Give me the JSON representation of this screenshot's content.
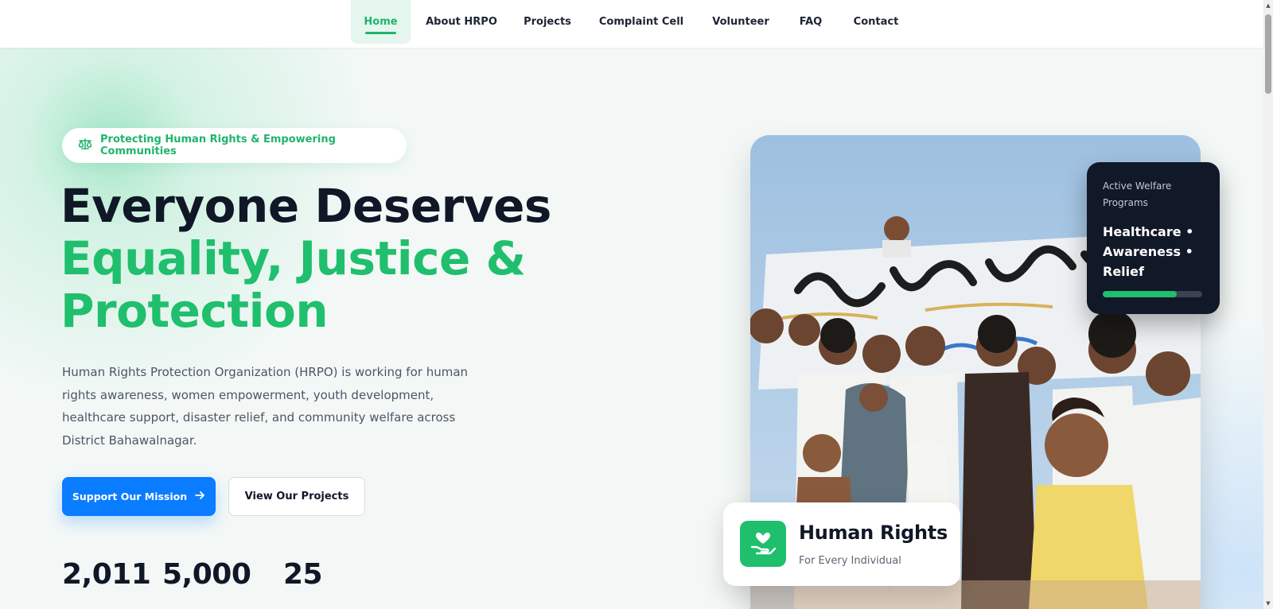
{
  "nav": {
    "items": [
      {
        "label": "Home",
        "active": true
      },
      {
        "label": "About HRPO",
        "active": false
      },
      {
        "label": "Projects",
        "active": false
      },
      {
        "label": "Complaint Cell",
        "active": false
      },
      {
        "label": "Volunteer",
        "active": false
      },
      {
        "label": "FAQ",
        "active": false
      },
      {
        "label": "Contact",
        "active": false
      }
    ]
  },
  "hero": {
    "badge_icon": "scales-icon",
    "badge_text": "Protecting Human Rights & Empowering Communities",
    "headline_line1": "Everyone Deserves",
    "headline_line2": "Equality, Justice &",
    "headline_line3": "Protection",
    "description": "Human Rights Protection Organization (HRPO) is working for human rights awareness, women empowerment, youth development, healthcare support, disaster relief, and community welfare across District Bahawalnagar.",
    "primary_button": "Support Our Mission",
    "primary_button_icon": "arrow-right-icon",
    "secondary_button": "View Our Projects",
    "stats": [
      "2,011",
      "5,000",
      "25"
    ]
  },
  "welfare_card": {
    "label": "Active Welfare Programs",
    "programs": "Healthcare • Awareness • Relief",
    "progress": 0.74
  },
  "rights_card": {
    "icon": "heart-hand-icon",
    "title": "Human Rights",
    "subtitle": "For Every Individual"
  },
  "colors": {
    "accent_green": "#1fbf6d",
    "primary_blue": "#0a7cff",
    "dark": "#111827"
  }
}
